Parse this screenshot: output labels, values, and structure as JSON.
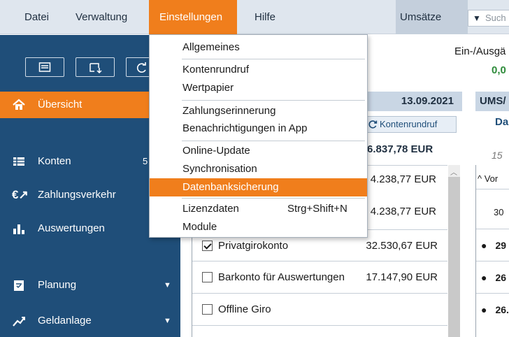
{
  "menubar": {
    "items": [
      {
        "label": "Datei"
      },
      {
        "label": "Verwaltung"
      },
      {
        "label": "Einstellungen",
        "active": true
      },
      {
        "label": "Hilfe"
      }
    ],
    "category_select": "Umsätze",
    "search_placeholder": "Such"
  },
  "dropdown": {
    "items": [
      {
        "label": "Allgemeines"
      },
      {
        "label": "Kontenrundruf"
      },
      {
        "label": "Wertpapier"
      },
      {
        "label": "Zahlungserinnerung"
      },
      {
        "label": "Benachrichtigungen in App"
      },
      {
        "label": "Online-Update"
      },
      {
        "label": "Synchronisation"
      },
      {
        "label": "Datenbanksicherung",
        "highlighted": true
      },
      {
        "label": "Lizenzdaten",
        "shortcut": "Strg+Shift+N"
      },
      {
        "label": "Module"
      }
    ]
  },
  "sidebar": {
    "items": [
      {
        "label": "Übersicht",
        "icon": "home-icon",
        "active": true
      },
      {
        "label": "Konten",
        "icon": "accounts-icon"
      },
      {
        "label": "Zahlungsverkehr",
        "icon": "euro-transfer-icon"
      },
      {
        "label": "Auswertungen",
        "icon": "bar-chart-icon"
      },
      {
        "label": "Planung",
        "icon": "calendar-icon"
      },
      {
        "label": "Geldanlage",
        "icon": "growth-chart-icon"
      }
    ],
    "konten_badge_partial": "5"
  },
  "overview": {
    "income_expense_label": "Ein-/Ausgä",
    "income_expense_value": "0,0",
    "panel_date": "13.09.2021",
    "refresh_button": "Kontenrundruf",
    "total": "6.837,78 EUR",
    "amount_1": "4.238,77 EUR",
    "amount_2": "4.238,77 EUR",
    "accounts": [
      {
        "name": "Privatgirokonto",
        "amount": "32.530,67 EUR",
        "checked": true
      },
      {
        "name": "Barkonto für Auswertungen",
        "amount": "17.147,90 EUR",
        "checked": false
      },
      {
        "name": "Offline Giro",
        "amount": "",
        "checked": false
      }
    ]
  },
  "umsaetze": {
    "header": "UMS/",
    "subheader": "Da",
    "date_hint": "15",
    "vor_label": "^ Vor",
    "row_value": "30",
    "bullets": [
      "29",
      "26",
      "26."
    ]
  },
  "colors": {
    "accent": "#f07e1c",
    "sidebar": "#1f4e79",
    "positive": "#2e8b3a"
  }
}
